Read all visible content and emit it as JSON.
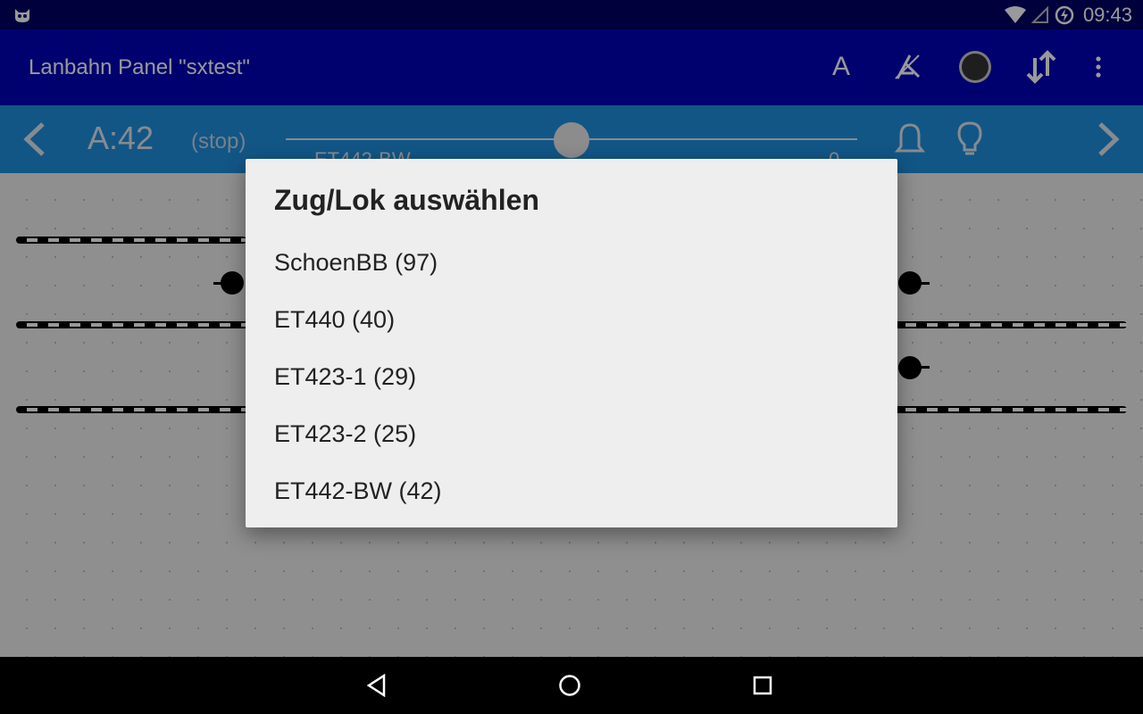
{
  "status_bar": {
    "time": "09:43",
    "icons": [
      "debug-cat-icon",
      "wifi-icon",
      "cell-signal-icon",
      "battery-charging-icon"
    ]
  },
  "action_bar": {
    "title": "Lanbahn Panel \"sxtest\"",
    "actions": {
      "address_label": "A",
      "route_clear_icon": "route-clear-icon",
      "power_icon": "power-status-icon",
      "sort_icon": "sort-icon",
      "menu_icon": "overflow-menu-icon"
    },
    "colors": {
      "background": "#0000b8",
      "status_background": "#000066"
    }
  },
  "loco_bar": {
    "address": "A:42",
    "state": "(stop)",
    "name": "ET442-BW",
    "speed": "0",
    "speed_fraction": 0.5,
    "colors": {
      "background": "#1e90e0"
    }
  },
  "dialog": {
    "title": "Zug/Lok auswählen",
    "items": [
      {
        "label": "SchoenBB (97)"
      },
      {
        "label": "ET440 (40)"
      },
      {
        "label": "ET423-1 (29)"
      },
      {
        "label": "ET423-2 (25)"
      },
      {
        "label": "ET442-BW (42)"
      }
    ]
  },
  "nav_bar": {
    "buttons": [
      "back-icon",
      "home-icon",
      "recents-icon"
    ]
  }
}
